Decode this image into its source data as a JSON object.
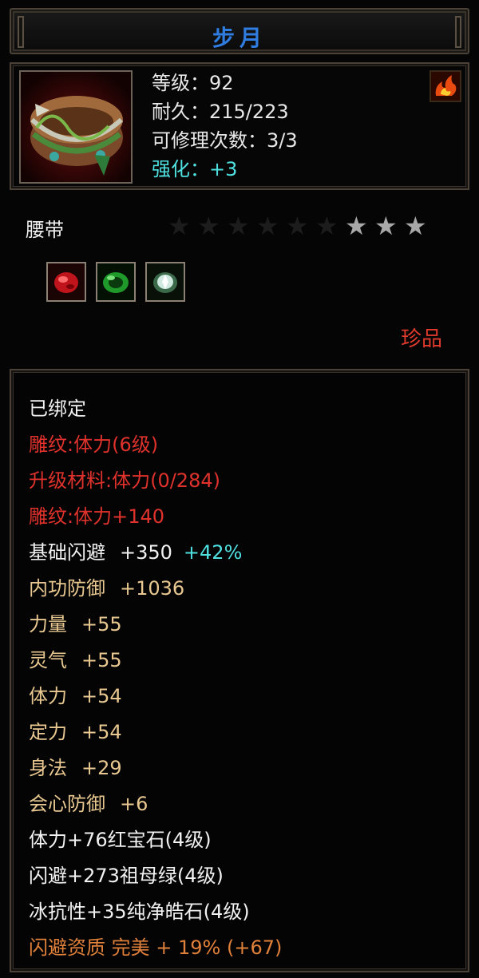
{
  "item": {
    "name": "步月",
    "type": "腰带",
    "quality": "珍品",
    "icon": "belt-icon",
    "badge_icon": "flame-icon"
  },
  "header_stats": [
    {
      "text": "等级：92",
      "color": "white"
    },
    {
      "text": "耐久：215/223",
      "color": "white"
    },
    {
      "text": "可修理次数：3/3",
      "color": "white"
    },
    {
      "text": "强化：+3",
      "color": "cyan"
    }
  ],
  "stars": {
    "total": 9,
    "lit": 3
  },
  "gems": [
    {
      "icon": "ruby-gem-icon",
      "color": "#c0141c"
    },
    {
      "icon": "emerald-gem-icon",
      "color": "#1f9a2a"
    },
    {
      "icon": "diamond-gem-icon",
      "color": "#cfe8e0"
    }
  ],
  "attributes": {
    "bound": "已绑定",
    "engrave_level": "雕纹:体力(6级)",
    "upgrade_material": "升级材料:体力(0/284)",
    "engrave_bonus": "雕纹:体力+140",
    "base_dodge": {
      "label": "基础闪避",
      "value": "+350",
      "extra": "+42%"
    },
    "inner_defense": {
      "label": "内功防御",
      "value": "+1036"
    },
    "strength": {
      "label": "力量",
      "value": "+55"
    },
    "spirit": {
      "label": "灵气",
      "value": "+55"
    },
    "stamina": {
      "label": "体力",
      "value": "+54"
    },
    "focus": {
      "label": "定力",
      "value": "+54"
    },
    "agility": {
      "label": "身法",
      "value": "+29"
    },
    "crit_defense": {
      "label": "会心防御",
      "value": "+6"
    },
    "gem_line_1": "体力+76红宝石(4级)",
    "gem_line_2": "闪避+273祖母绿(4级)",
    "gem_line_3": "冰抗性+35纯净皓石(4级)",
    "aptitude": "闪避资质 完美 + 19% (+67)"
  },
  "colors": {
    "title": "#2f7de0",
    "red_text": "#e0322c",
    "tan_text": "#e8c890",
    "cyan_text": "#4fe0e0",
    "orange_text": "#e0803a",
    "border": "#4a4238"
  }
}
